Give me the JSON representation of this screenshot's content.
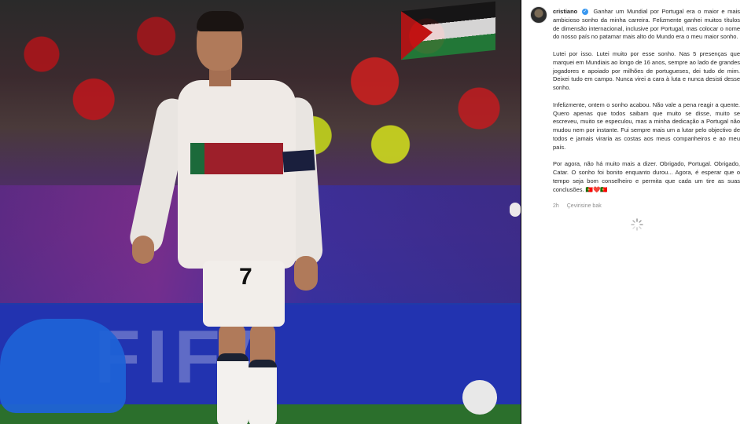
{
  "post": {
    "username": "cristiano",
    "verified_icon": "verified-check-icon",
    "caption_paragraphs": [
      "Ganhar um Mundial por Portugal era o maior e mais ambicioso sonho da minha carreira. Felizmente ganhei muitos títulos de dimensão internacional, inclusive por Portugal, mas colocar o nome do nosso país no patamar mais alto do Mundo era o meu maior sonho.",
      "Lutei por isso. Lutei muito por esse sonho. Nas 5 presenças que marquei em Mundiais ao longo de 16 anos, sempre ao lado de grandes jogadores e apoiado por milhões de portugueses, dei tudo de mim. Deixei tudo em campo. Nunca virei a cara à luta e nunca desisti desse sonho.",
      "Infelizmente, ontem o sonho acabou. Não vale a pena reagir a quente. Quero apenas que todos saibam que muito se disse, muito se escreveu, muito se especulou, mas a minha dedicação a Portugal não mudou nem por instante. Fui sempre mais um a lutar pelo objectivo de todos e jamais viraria as costas aos meus companheiros e ao meu país.",
      "Por agora, não há muito mais a dizer. Obrigado, Portugal. Obrigado, Catar. O sonho foi bonito enquanto durou... Agora, é esperar que o tempo seja bom conselheiro e permita que cada um tire as suas conclusões."
    ],
    "caption_emoji": "🇵🇹❤️🇵🇹",
    "time_ago": "2h",
    "translate_label": "Çevirisine bak"
  },
  "photo": {
    "jersey_number": "7",
    "board_text": "FIFA"
  }
}
